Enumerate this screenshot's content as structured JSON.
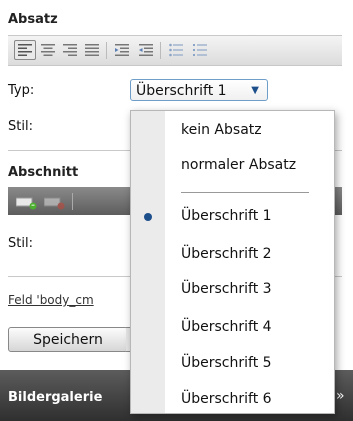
{
  "absatz": {
    "title": "Absatz",
    "typ_label": "Typ:",
    "stil_label": "Stil:",
    "typ_value": "Überschrift 1"
  },
  "abschnitt": {
    "title": "Abschnitt",
    "stil_label": "Stil:"
  },
  "field_link": "Feld 'body_cm",
  "save_label": "Speichern",
  "gallery": {
    "title": "Bildergalerie",
    "more": "»"
  },
  "dropdown": {
    "items": [
      "kein Absatz",
      "normaler Absatz",
      "Überschrift 1",
      "Überschrift 2",
      "Überschrift 3",
      "Überschrift 4",
      "Überschrift 5",
      "Überschrift 6"
    ],
    "selected": "Überschrift 1"
  },
  "toolbar_icons": [
    "align-left-icon",
    "align-center-icon",
    "align-right-icon",
    "align-justify-icon",
    "outdent-icon",
    "indent-icon",
    "bulleted-list-icon",
    "numbered-list-icon"
  ],
  "colors": {
    "accent": "#1d4f8b",
    "select_border": "#6f9ec9",
    "bottom_bar": "#3a3a3a"
  }
}
